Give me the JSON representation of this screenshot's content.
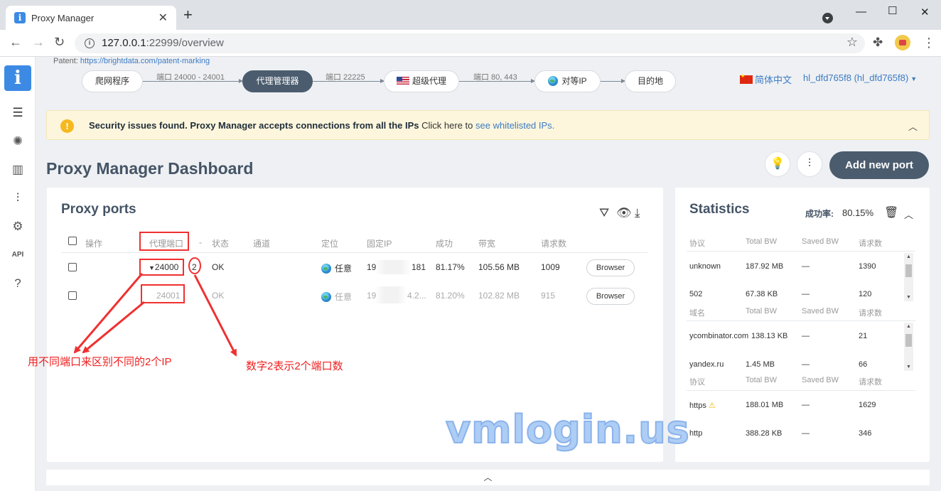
{
  "browser": {
    "tab_title": "Proxy Manager",
    "url_host": "127.0.0.1",
    "url_path": ":22999/overview"
  },
  "patent": {
    "label": "Patent:",
    "link": "https://brightdata.com/patent-marking"
  },
  "chain": {
    "nodes": [
      "爬网程序",
      "代理管理器",
      "超级代理",
      "对等IP",
      "目的地"
    ],
    "ports": [
      "端口 24000 - 24001",
      "端口 22225",
      "端口 80, 443"
    ]
  },
  "lang": "简体中文",
  "user": "hl_dfd765f8 (hl_dfd765f8)",
  "banner": {
    "bold": "Security issues found. Proxy Manager accepts connections from all the IPs",
    "text": " Click here to ",
    "link": "see whitelisted IPs."
  },
  "title": "Proxy Manager Dashboard",
  "add_port": "Add new port",
  "ports_panel": {
    "title": "Proxy ports",
    "columns": [
      "操作",
      "代理端口",
      "-",
      "状态",
      "通道",
      "定位",
      "固定IP",
      "成功",
      "带宽",
      "请求数"
    ],
    "rows": [
      {
        "port": "24000",
        "count": "2",
        "status": "OK",
        "geo": "任意",
        "ip_start": "19",
        "ip_end": "181",
        "success": "81.17%",
        "bandwidth": "105.56 MB",
        "requests": "1009",
        "action": "Browser"
      },
      {
        "port": "24001",
        "count": "",
        "status": "OK",
        "geo": "任意",
        "ip_start": "19",
        "ip_end": "4.2...",
        "success": "81.20%",
        "bandwidth": "102.82 MB",
        "requests": "915",
        "action": "Browser"
      }
    ]
  },
  "stats": {
    "title": "Statistics",
    "success_label": "成功率:",
    "success_value": "80.15%",
    "protocol": {
      "headers": [
        "协议",
        "Total BW",
        "Saved BW",
        "请求数"
      ],
      "rows": [
        {
          "name": "unknown",
          "total": "187.92 MB",
          "saved": "—",
          "req": "1390"
        },
        {
          "name": "502",
          "total": "67.38 KB",
          "saved": "—",
          "req": "120"
        }
      ]
    },
    "domain": {
      "headers": [
        "域名",
        "Total BW",
        "Saved BW",
        "请求数"
      ],
      "rows": [
        {
          "name": "ycombinator.com",
          "total": "138.13 KB",
          "saved": "—",
          "req": "21"
        },
        {
          "name": "yandex.ru",
          "total": "1.45 MB",
          "saved": "—",
          "req": "66"
        }
      ]
    },
    "protocol2": {
      "headers": [
        "协议",
        "Total BW",
        "Saved BW",
        "请求数"
      ],
      "rows": [
        {
          "name": "https",
          "total": "188.01 MB",
          "saved": "—",
          "req": "1629"
        },
        {
          "name": "http",
          "total": "388.28 KB",
          "saved": "—",
          "req": "346"
        }
      ]
    }
  },
  "annotations": {
    "left": "用不同端口来区别不同的2个IP",
    "right": "数字2表示2个端口数"
  },
  "watermark": "vmlogin.us",
  "colors": {
    "accent": "#3d8ae4",
    "dark_button": "#4b5c6e",
    "annotation": "#f03030",
    "banner_bg": "#fdf6dc"
  }
}
